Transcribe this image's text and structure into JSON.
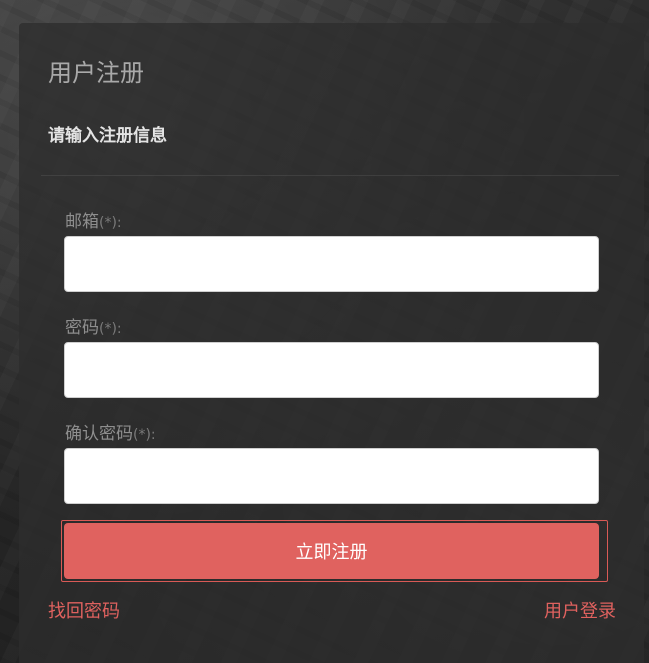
{
  "panel": {
    "title": "用户注册",
    "subtitle": "请输入注册信息"
  },
  "form": {
    "fields": [
      {
        "label": "邮箱",
        "required_mark": "(*):",
        "value": "",
        "placeholder": ""
      },
      {
        "label": "密码",
        "required_mark": "(*):",
        "value": "",
        "placeholder": ""
      },
      {
        "label": "确认密码",
        "required_mark": "(*):",
        "value": "",
        "placeholder": ""
      }
    ],
    "submit_label": "立即注册"
  },
  "links": {
    "forgot_password": "找回密码",
    "login": "用户登录"
  },
  "colors": {
    "accent": "#e0625f",
    "panel_background": "#2d2d2d"
  }
}
